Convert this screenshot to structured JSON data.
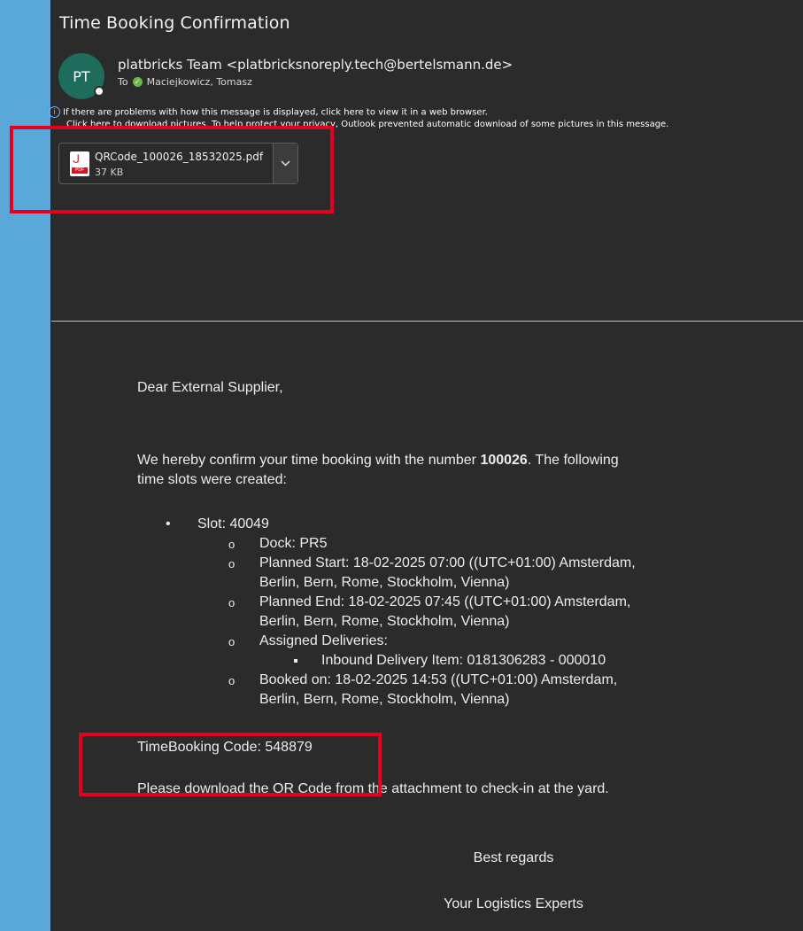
{
  "email": {
    "subject": "Time Booking Confirmation",
    "avatar_initials": "PT",
    "sender": "platbricks Team <platbricksnoreply.tech@bertelsmann.de>",
    "to_label": "To",
    "recipient": "Maciejkowicz, Tomasz",
    "info_line1": "If there are problems with how this message is displayed, click here to view it in a web browser.",
    "info_line2": "Click here to download pictures. To help protect your privacy, Outlook prevented automatic download of some pictures in this message.",
    "attachment": {
      "name": "QRCode_100026_18532025.pdf",
      "size": "37 KB"
    }
  },
  "body": {
    "greeting": "Dear External Supplier,",
    "intro_pre": "We hereby confirm your time booking with the number ",
    "booking_number": "100026",
    "intro_post": ". The following",
    "intro_line2": "time slots were created:",
    "slot": "Slot: 40049",
    "dock": "Dock: PR5",
    "planned_start_1": "Planned Start: 18-02-2025 07:00 ((UTC+01:00) Amsterdam,",
    "planned_start_2": "Berlin, Bern, Rome, Stockholm, Vienna)",
    "planned_end_1": "Planned End: 18-02-2025 07:45 ((UTC+01:00) Amsterdam,",
    "planned_end_2": "Berlin, Bern, Rome, Stockholm, Vienna)",
    "assigned": "Assigned Deliveries:",
    "delivery_item": "Inbound Delivery Item: 0181306283 - 000010",
    "booked_1": "Booked on: 18-02-2025 14:53 ((UTC+01:00) Amsterdam,",
    "booked_2": "Berlin, Bern, Rome, Stockholm, Vienna)",
    "code": "TimeBooking Code: 548879",
    "download_note": "Please download the QR Code from the attachment to check-in at the yard.",
    "regards": "Best regards",
    "signature": "Your Logistics Experts"
  },
  "colors": {
    "highlight": "#e5001f",
    "background": "#2b2b2b",
    "desktop": "#5aa7d9",
    "avatar": "#1d6c5c"
  }
}
